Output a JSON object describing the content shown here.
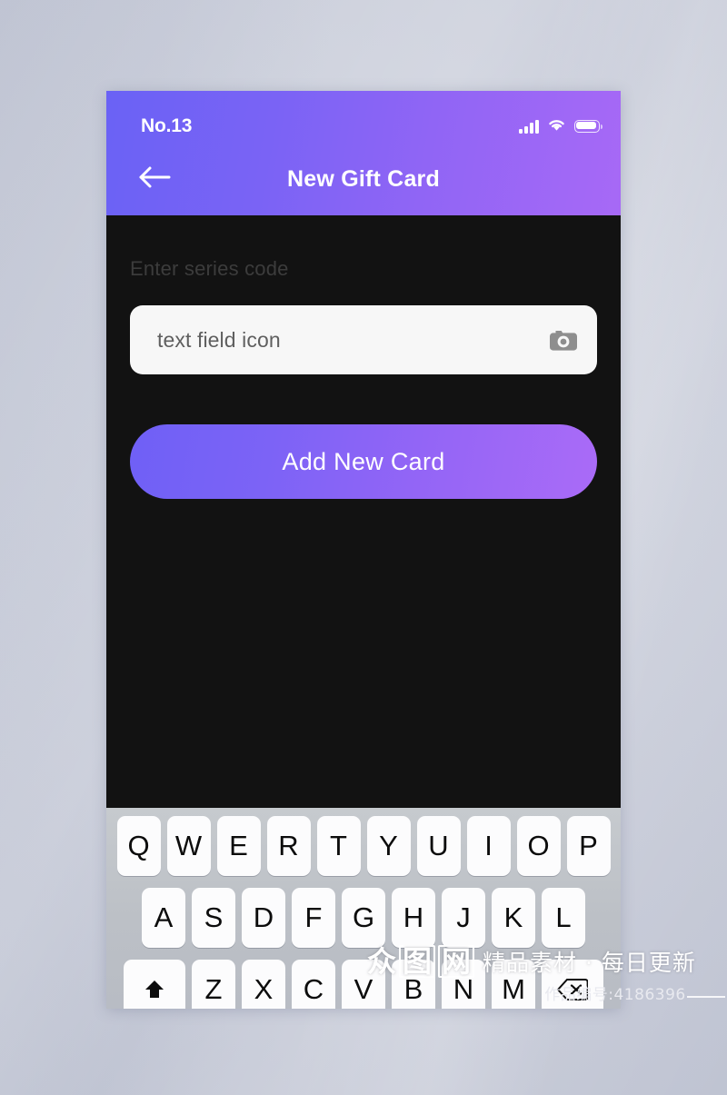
{
  "statusbar": {
    "carrier": "No.13",
    "signal_icon": "signal-bars-icon",
    "wifi_icon": "wifi-icon",
    "battery_icon": "battery-icon"
  },
  "navbar": {
    "back_icon": "arrow-left-icon",
    "title": "New Gift Card"
  },
  "form": {
    "label": "Enter series code",
    "input_value": "",
    "input_placeholder": "text field icon",
    "trailing_icon": "camera-icon",
    "submit_label": "Add New Card"
  },
  "keyboard": {
    "row1": [
      "Q",
      "W",
      "E",
      "R",
      "T",
      "Y",
      "U",
      "I",
      "O",
      "P"
    ],
    "row2": [
      "A",
      "S",
      "D",
      "F",
      "G",
      "H",
      "J",
      "K",
      "L"
    ],
    "row3_letters": [
      "Z",
      "X",
      "C",
      "V",
      "B",
      "N",
      "M"
    ],
    "shift_icon": "shift-arrow-up-icon",
    "backspace_icon": "backspace-delete-icon"
  },
  "watermark": {
    "logo_chars": [
      "众",
      "图",
      "网"
    ],
    "tagline": "精品素材 · 每日更新",
    "item_id": "作品编号:4186396"
  },
  "colors": {
    "gradient_start": "#6a62f5",
    "gradient_end": "#a769f6",
    "screen_bg": "#121212",
    "field_bg": "#f7f7f7",
    "label_text": "#3c3c3c",
    "keyboard_bg": "#bcc0c6",
    "page_bg": "#c3c7d5"
  }
}
